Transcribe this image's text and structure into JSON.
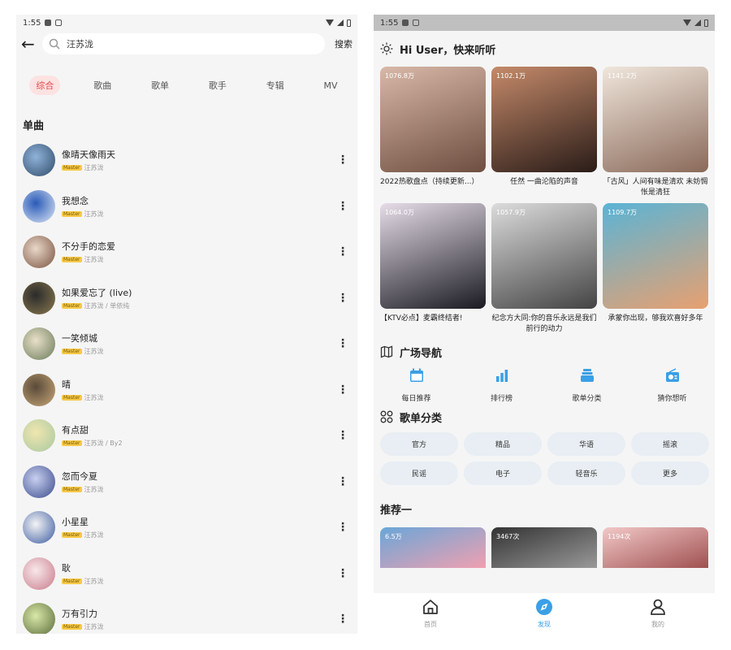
{
  "left": {
    "status": {
      "time": "1:55"
    },
    "search": {
      "query": "汪苏泷",
      "button": "搜索"
    },
    "tabs": [
      "综合",
      "歌曲",
      "歌单",
      "歌手",
      "专辑",
      "MV"
    ],
    "section_title": "单曲",
    "badge": "Master",
    "songs": [
      {
        "title": "像晴天像雨天",
        "artist": "汪苏泷"
      },
      {
        "title": "我想念",
        "artist": "汪苏泷"
      },
      {
        "title": "不分手的恋爱",
        "artist": "汪苏泷"
      },
      {
        "title": "如果爱忘了 (live)",
        "artist": "汪苏泷 / 单依纯"
      },
      {
        "title": "一笑倾城",
        "artist": "汪苏泷"
      },
      {
        "title": "晴",
        "artist": "汪苏泷"
      },
      {
        "title": "有点甜",
        "artist": "汪苏泷 / By2"
      },
      {
        "title": "忽而今夏",
        "artist": "汪苏泷"
      },
      {
        "title": "小星星",
        "artist": "汪苏泷"
      },
      {
        "title": "耿",
        "artist": "汪苏泷"
      },
      {
        "title": "万有引力",
        "artist": "汪苏泷"
      }
    ],
    "more_glyph": "⋮"
  },
  "right": {
    "status": {
      "time": "1:55"
    },
    "greeting": "Hi User，快来听听",
    "playlists": [
      {
        "count": "1076.8万",
        "title": "2022热歌盘点（持续更新...）",
        "color1": "#d9b8a8",
        "color2": "#6e4e40"
      },
      {
        "count": "1102.1万",
        "title": "任然 一曲沦陷的声音",
        "color1": "#c58a6a",
        "color2": "#2a1c18"
      },
      {
        "count": "1141.2万",
        "title": "「古风」人间有味是清欢 未妨惆怅是清狂",
        "color1": "#f0e6dc",
        "color2": "#8a6a5a"
      },
      {
        "count": "1064.0万",
        "title": "【KTV必点】麦霸终结者!",
        "color1": "#e6dde8",
        "color2": "#1a1a22"
      },
      {
        "count": "1057.9万",
        "title": "纪念方大同:你的音乐永远是我们前行的动力",
        "color1": "#dcdcdc",
        "color2": "#444444"
      },
      {
        "count": "1109.7万",
        "title": "承蒙你出现，够我欢喜好多年",
        "color1": "#5ab4d6",
        "color2": "#e8a070"
      }
    ],
    "plaza_title": "广场导航",
    "plaza": [
      {
        "label": "每日推荐",
        "icon": "calendar-icon"
      },
      {
        "label": "排行榜",
        "icon": "bar-chart-icon"
      },
      {
        "label": "歌单分类",
        "icon": "stack-icon"
      },
      {
        "label": "猜你想听",
        "icon": "radio-icon"
      }
    ],
    "category_title": "歌单分类",
    "categories": [
      "官方",
      "精品",
      "华语",
      "摇滚",
      "民谣",
      "电子",
      "轻音乐",
      "更多"
    ],
    "recommend_title": "推荐一",
    "recommend": [
      {
        "count": "6.5万",
        "color1": "#6aa6d8",
        "color2": "#f0a0b0"
      },
      {
        "count": "3467次",
        "color1": "#333333",
        "color2": "#999999"
      },
      {
        "count": "1194次",
        "color1": "#f2c8c8",
        "color2": "#a05050"
      }
    ],
    "bottom_nav": [
      {
        "label": "首页",
        "icon": "home-icon"
      },
      {
        "label": "发现",
        "icon": "discover-icon"
      },
      {
        "label": "我的",
        "icon": "user-icon"
      }
    ],
    "accent": "#3aa0e6"
  }
}
